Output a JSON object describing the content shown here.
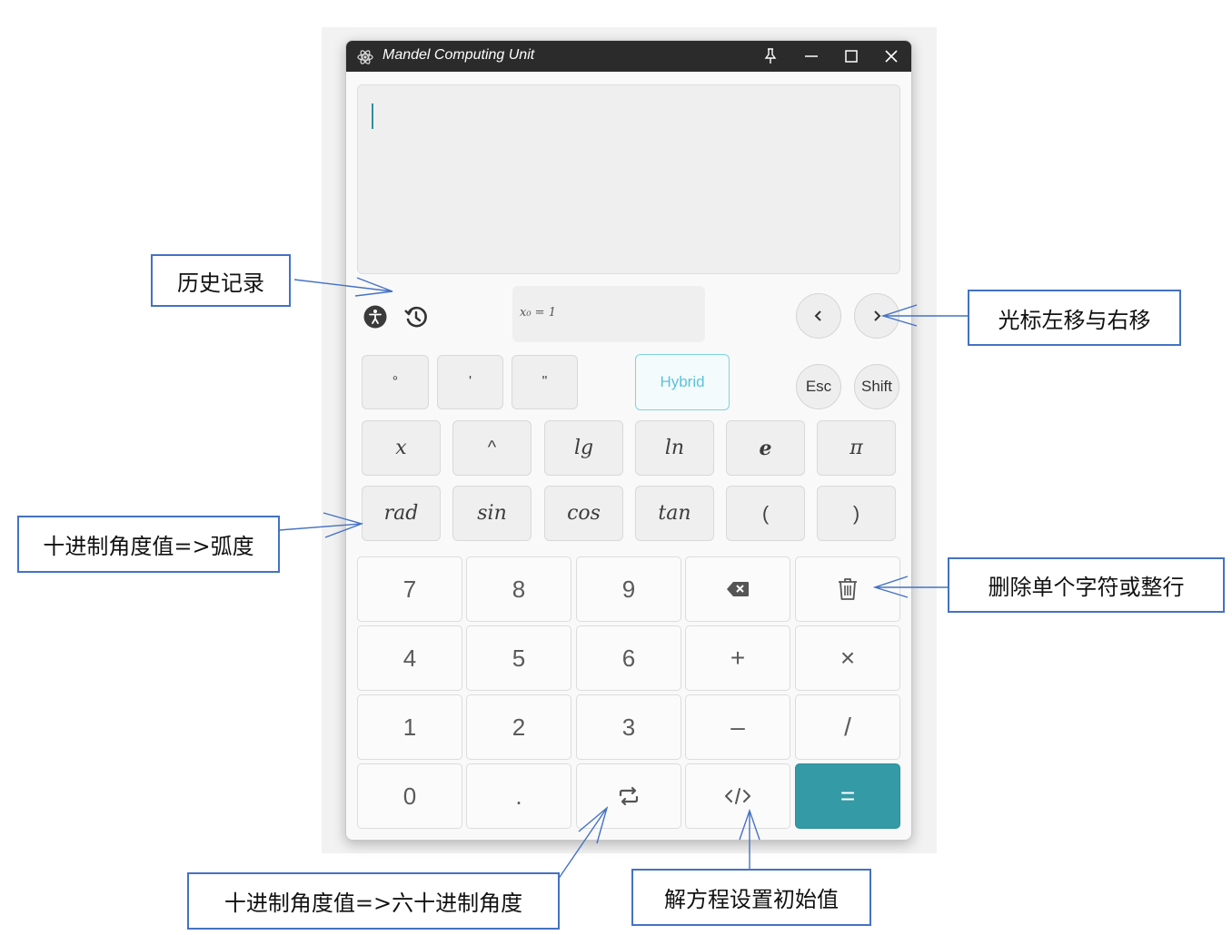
{
  "window": {
    "title": "Mandel Computing Unit",
    "icons": [
      "atom-icon",
      "pin-icon",
      "minimize-icon",
      "maximize-icon",
      "close-icon"
    ]
  },
  "display": {
    "content": ""
  },
  "toolbar": {
    "hint_text": "x₀ = 1",
    "icons": [
      "accessibility-icon",
      "history-icon",
      "cursor-left-icon",
      "cursor-right-icon"
    ]
  },
  "keys": {
    "row1": {
      "degree": "°",
      "minute": "'",
      "second": "\"",
      "hybrid": "Hybrid",
      "esc": "Esc",
      "shift": "Shift"
    },
    "row2": [
      "x",
      "^",
      "lg",
      "ln",
      "e",
      "π"
    ],
    "row3": [
      "rad",
      "sin",
      "cos",
      "tan",
      "(",
      ")"
    ]
  },
  "numpad": {
    "row1": [
      "7",
      "8",
      "9"
    ],
    "row2": [
      "4",
      "5",
      "6",
      "+",
      "×"
    ],
    "row3": [
      "1",
      "2",
      "3",
      "–",
      "/"
    ],
    "row4": [
      "0",
      ".",
      "="
    ],
    "icons": [
      "backspace-icon",
      "trash-icon",
      "convert-icon",
      "code-icon"
    ]
  },
  "colors": {
    "accent": "#349aa6",
    "hybrid": "#5cc2d8",
    "titlebar": "#2b2b2b",
    "callout_border": "#4472c4"
  },
  "callouts": {
    "history": "历史记录",
    "cursor": "光标左移与右移",
    "rad": "十进制角度值=>弧度",
    "delete": "删除单个字符或整行",
    "sexagesimal": "十进制角度值=>六十进制角度",
    "solve": "解方程设置初始值"
  }
}
